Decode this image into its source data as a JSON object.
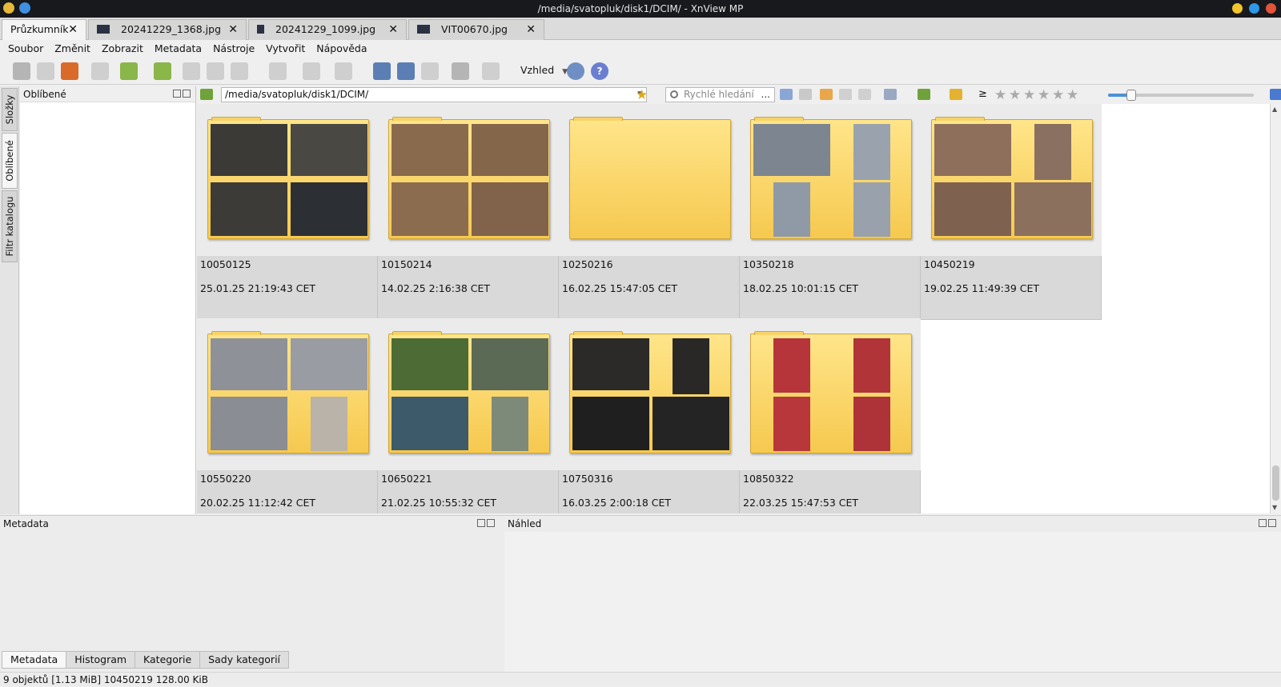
{
  "window": {
    "title": "/media/svatopluk/disk1/DCIM/ - XnView MP"
  },
  "tabs": [
    {
      "label": "Průzkumník",
      "active": true
    },
    {
      "label": "20241229_1368.jpg",
      "active": false
    },
    {
      "label": "20241229_1099.jpg",
      "active": false
    },
    {
      "label": "VIT00670.jpg",
      "active": false
    }
  ],
  "menu": [
    "Soubor",
    "Změnit",
    "Zobrazit",
    "Metadata",
    "Nástroje",
    "Vytvořit",
    "Nápověda"
  ],
  "toolbar": {
    "view_label": "Vzhled",
    "help_glyph": "?"
  },
  "side_tabs": [
    "Složky",
    "Oblíbené",
    "Filtr katalogu"
  ],
  "favorites_panel": {
    "title": "Oblíbené"
  },
  "address": {
    "path": "/media/svatopluk/disk1/DCIM/",
    "search_placeholder": "Rychlé hledání",
    "search_more": "...",
    "filter_symbol": "≥"
  },
  "folders": [
    {
      "name": "10050125",
      "date": "25.01.25 21:19:43 CET",
      "palette": [
        "#3b3a37",
        "#4a4843",
        "#3d3b37",
        "#2c3035"
      ]
    },
    {
      "name": "10150214",
      "date": "14.02.25 2:16:38 CET",
      "palette": [
        "#8a6a4c",
        "#84664a",
        "#8c6c4e",
        "#80634a"
      ]
    },
    {
      "name": "10250216",
      "date": "16.02.25 15:47:05 CET",
      "palette": []
    },
    {
      "name": "10350218",
      "date": "18.02.25 10:01:15 CET",
      "palette": [
        "#7d8590",
        "#9aa3ad",
        "#8f9aa6",
        "#98a1ac"
      ]
    },
    {
      "name": "10450219",
      "date": "19.02.25 11:49:39 CET",
      "palette": [
        "#8d6f5c",
        "#8a7060",
        "#7f614f",
        "#8b705d"
      ]
    },
    {
      "name": "10550220",
      "date": "20.02.25 11:12:42 CET",
      "palette": [
        "#8f9198",
        "#9a9ca3",
        "#8a8d94",
        "#b9b3a9"
      ]
    },
    {
      "name": "10650221",
      "date": "21.02.25 10:55:32 CET",
      "palette": [
        "#4d6b34",
        "#5b6a54",
        "#3d5a6a",
        "#7d8a7a"
      ]
    },
    {
      "name": "10750316",
      "date": "16.03.25 2:00:18 CET",
      "palette": [
        "#2c2a28",
        "#2a2826",
        "#1f1f1f",
        "#242424"
      ]
    },
    {
      "name": "10850322",
      "date": "22.03.25 15:47:53 CET",
      "palette": [
        "#b5353a",
        "#b03438",
        "#b8373b",
        "#ad3338"
      ]
    }
  ],
  "bottom_panels": {
    "metadata_title": "Metadata",
    "preview_title": "Náhled"
  },
  "bottom_tabs": [
    {
      "label": "Metadata",
      "active": true
    },
    {
      "label": "Histogram",
      "active": false
    },
    {
      "label": "Kategorie",
      "active": false
    },
    {
      "label": "Sady kategorií",
      "active": false
    }
  ],
  "status": {
    "text": "9 objektů [1.13 MiB]  10450219  128.00 KiB"
  },
  "colors": {
    "folder_yellow": "#f6c94f",
    "selection_grey": "#d9d9d9",
    "accent_blue": "#4a90d9"
  }
}
